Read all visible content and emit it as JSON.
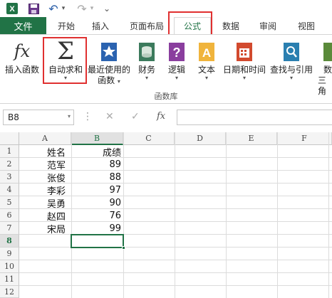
{
  "quick_access": {
    "save_icon": "save-icon",
    "undo_icon": "undo-icon",
    "redo_icon": "redo-icon",
    "undo_glyph": "↶",
    "redo_glyph": "↷",
    "dropdown_glyph": "▾",
    "customize_glyph": "⌄"
  },
  "tabs": {
    "file": "文件",
    "items": [
      "开始",
      "插入",
      "页面布局",
      "公式",
      "数据",
      "审阅",
      "视图"
    ],
    "active": "公式"
  },
  "ribbon": {
    "insert_function": "插入函数",
    "autosum": "自动求和",
    "recent": "最近使用的",
    "recent_line2": "函数",
    "financial": "财务",
    "logical": "逻辑",
    "text": "文本",
    "datetime": "日期和时间",
    "lookup": "查找与引用",
    "math_line1": "数",
    "math_line2": "三角",
    "group_label": "函数库",
    "fx_glyph": "fx",
    "sigma_glyph": "Σ",
    "chevron": "▾"
  },
  "formula_bar": {
    "name_box": "B8",
    "cancel_glyph": "✕",
    "enter_glyph": "✓",
    "fx_glyph": "fx",
    "dots_glyph": "⋮",
    "formula": ""
  },
  "sheet": {
    "columns": [
      "A",
      "B",
      "C",
      "D",
      "E",
      "F"
    ],
    "rows": [
      "1",
      "2",
      "3",
      "4",
      "5",
      "6",
      "7",
      "8",
      "9",
      "10",
      "11",
      "12"
    ],
    "active_column": "B",
    "active_row": "8",
    "cells": [
      {
        "a": "姓名",
        "b": "成绩"
      },
      {
        "a": "范军",
        "b": "89"
      },
      {
        "a": "张俊",
        "b": "88"
      },
      {
        "a": "李彩",
        "b": "97"
      },
      {
        "a": "吴勇",
        "b": "90"
      },
      {
        "a": "赵四",
        "b": "76"
      },
      {
        "a": "宋局",
        "b": "99"
      }
    ]
  },
  "colors": {
    "excel_green": "#217346",
    "highlight_red": "#e03030"
  }
}
